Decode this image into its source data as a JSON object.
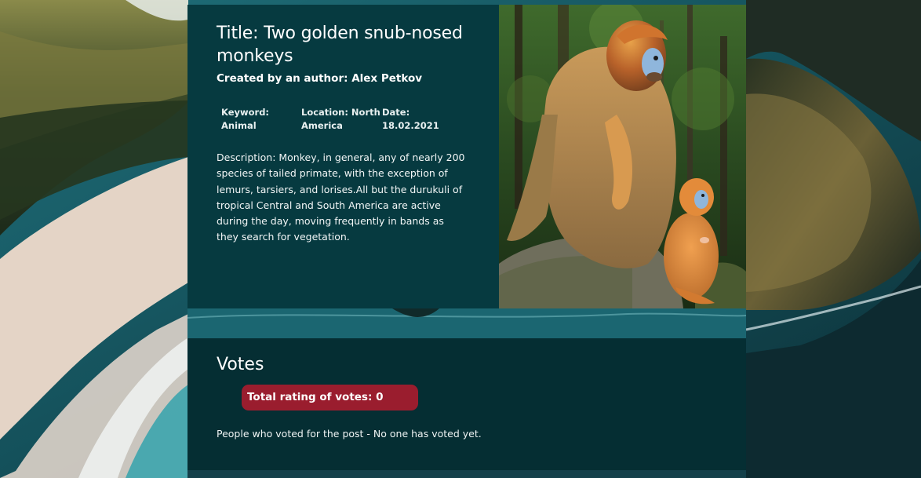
{
  "post": {
    "title": "Title: Two golden snub-nosed monkeys",
    "author": "Created by an author: Alex Petkov",
    "keyword": "Keyword: Animal",
    "location": "Location: North America",
    "date": "Date: 18.02.2021",
    "description": "Description: Monkey, in general, any of nearly 200 species of tailed primate, with the exception of lemurs, tarsiers, and lorises.All but the durukuli of tropical Central and South America are active during the day, moving frequently in bands as they search for vegetation."
  },
  "votes": {
    "heading": "Votes",
    "total_rating": "Total rating of votes: 0",
    "voters_text": "People who voted for the post - No one has voted yet."
  },
  "colors": {
    "card_background": "#063a40",
    "votes_background": "#052e33",
    "rating_badge": "#9a1d2e"
  }
}
